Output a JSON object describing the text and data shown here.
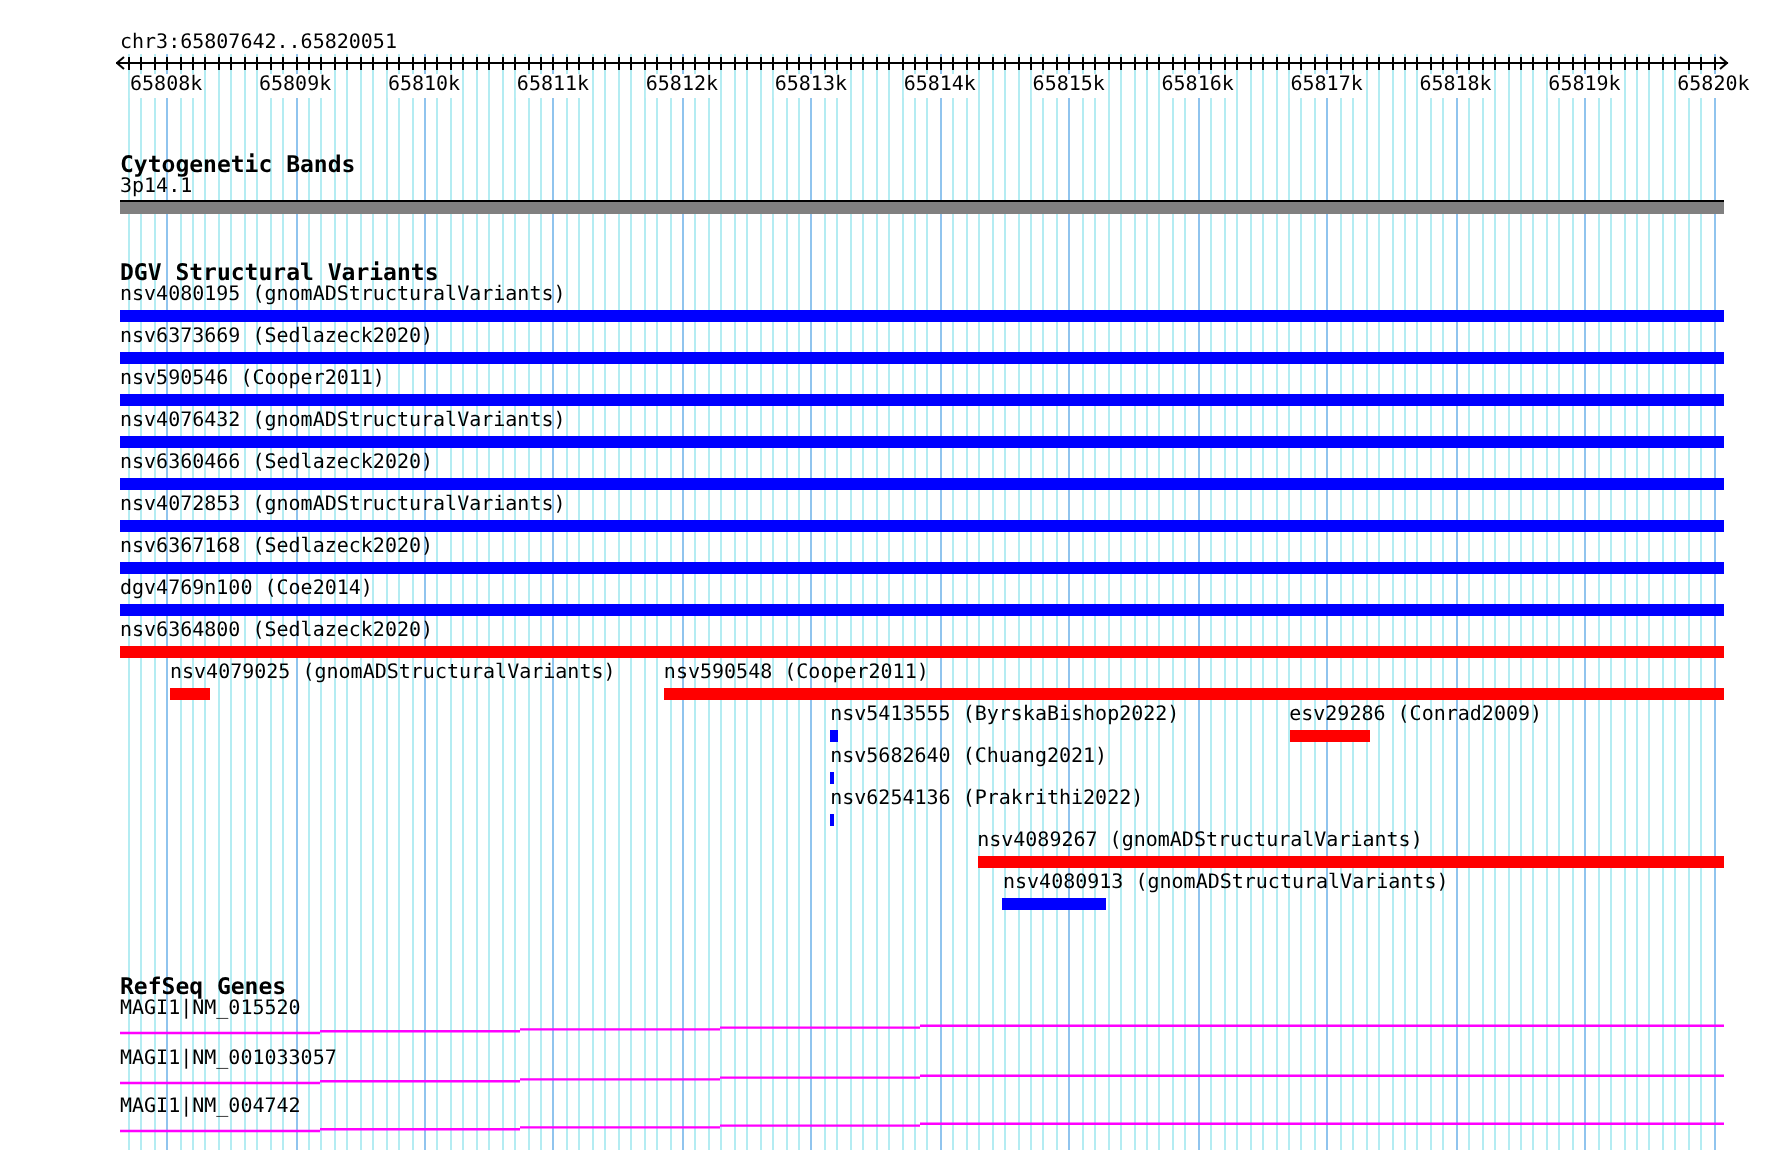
{
  "location": "chr3:65807642..65820051",
  "ruler": {
    "ticks": [
      {
        "label": "65808k"
      },
      {
        "label": "65809k"
      },
      {
        "label": "65810k"
      },
      {
        "label": "65811k"
      },
      {
        "label": "65812k"
      },
      {
        "label": "65813k"
      },
      {
        "label": "65814k"
      },
      {
        "label": "65815k"
      },
      {
        "label": "65816k"
      },
      {
        "label": "65817k"
      },
      {
        "label": "65818k"
      },
      {
        "label": "65819k"
      },
      {
        "label": "65820k"
      }
    ]
  },
  "cytogenetic_bands": {
    "title": "Cytogenetic Bands",
    "bands": [
      {
        "name": "3p14.1"
      }
    ]
  },
  "dgv_structural_variants": {
    "title": "DGV Structural Variants",
    "rows": [
      [
        {
          "label": "nsv4080195 (gnomADStructuralVariants)",
          "color": "#0000ff"
        }
      ],
      [
        {
          "label": "nsv6373669 (Sedlazeck2020)",
          "color": "#0000ff"
        }
      ],
      [
        {
          "label": "nsv590546 (Cooper2011)",
          "color": "#0000ff"
        }
      ],
      [
        {
          "label": "nsv4076432 (gnomADStructuralVariants)",
          "color": "#0000ff"
        }
      ],
      [
        {
          "label": "nsv6360466 (Sedlazeck2020)",
          "color": "#0000ff"
        }
      ],
      [
        {
          "label": "nsv4072853 (gnomADStructuralVariants)",
          "color": "#0000ff"
        }
      ],
      [
        {
          "label": "nsv6367168 (Sedlazeck2020)",
          "color": "#0000ff"
        }
      ],
      [
        {
          "label": "dgv4769n100 (Coe2014)",
          "color": "#0000ff"
        }
      ],
      [
        {
          "label": "nsv6364800 (Sedlazeck2020)",
          "color": "#ff0000"
        }
      ],
      [
        {
          "label": "nsv4079025 (gnomADStructuralVariants)",
          "color": "#ff0000"
        },
        {
          "label": "nsv590548 (Cooper2011)",
          "color": "#ff0000"
        }
      ],
      [
        {
          "label": "nsv5413555 (ByrskaBishop2022)",
          "color": "#0000ff"
        },
        {
          "label": "esv29286 (Conrad2009)",
          "color": "#ff0000"
        }
      ],
      [
        {
          "label": "nsv5682640 (Chuang2021)",
          "color": "#0000ff"
        }
      ],
      [
        {
          "label": "nsv6254136 (Prakrithi2022)",
          "color": "#0000ff"
        }
      ],
      [
        {
          "label": "nsv4089267 (gnomADStructuralVariants)",
          "color": "#ff0000"
        }
      ],
      [
        {
          "label": "nsv4080913 (gnomADStructuralVariants)",
          "color": "#0000ff"
        }
      ]
    ]
  },
  "refseq_genes": {
    "title": "RefSeq Genes",
    "genes": [
      {
        "label": "MAGI1|NM_015520"
      },
      {
        "label": "MAGI1|NM_001033057"
      },
      {
        "label": "MAGI1|NM_004742"
      }
    ]
  }
}
